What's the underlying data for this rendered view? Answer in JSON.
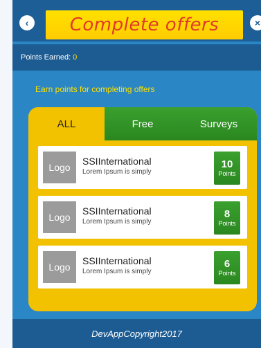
{
  "header": {
    "title": "Complete offers",
    "back_icon": "chevron-left-icon",
    "close_icon": "close-icon"
  },
  "points": {
    "label": "Points Earned:",
    "value": "0"
  },
  "instruction": "Earn points for completing offers",
  "tabs": [
    {
      "label": "ALL",
      "active": true
    },
    {
      "label": "Free",
      "active": false
    },
    {
      "label": "Surveys",
      "active": false
    }
  ],
  "offers": [
    {
      "logo": "Logo",
      "name": "SSIInternational",
      "desc": "Lorem Ipsum is simply",
      "points": "10",
      "unit": "Points"
    },
    {
      "logo": "Logo",
      "name": "SSIInternational",
      "desc": "Lorem Ipsum is simply",
      "points": "8",
      "unit": "Points"
    },
    {
      "logo": "Logo",
      "name": "SSIInternational",
      "desc": "Lorem Ipsum is simply",
      "points": "6",
      "unit": "Points"
    }
  ],
  "footer": "DevAppCopyright2017",
  "colors": {
    "accent_yellow": "#ffe100",
    "title_red": "#e03a2a",
    "green": "#2a8720",
    "blue": "#2b86c5",
    "dark_blue": "#1d5c93"
  }
}
